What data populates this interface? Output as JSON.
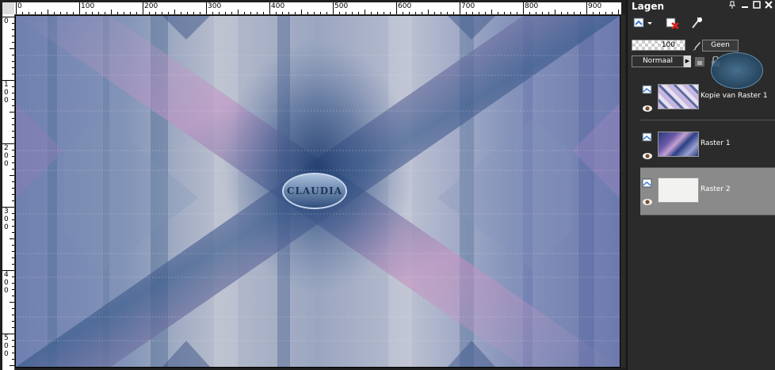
{
  "ruler": {
    "top_labels": [
      "0",
      "100",
      "200",
      "300",
      "400",
      "500",
      "600",
      "700",
      "800",
      "900"
    ],
    "left_labels": [
      "0",
      "100",
      "200",
      "300",
      "400",
      "500"
    ]
  },
  "layers_panel": {
    "title": "Lagen",
    "opacity_value": "100",
    "blend_button": "Geen",
    "mode": "Normaal",
    "layers": [
      {
        "name": "Kopie van Raster 1",
        "selected": false
      },
      {
        "name": "Raster 1",
        "selected": false
      },
      {
        "name": "Raster 2",
        "selected": true
      }
    ]
  },
  "watermark": {
    "text": "CLAUDIA"
  },
  "colors": {
    "workspace_bg": "#1f1f1f",
    "panel_bg": "#2b2b2b",
    "selected_row": "#8a8a8a"
  },
  "icons": [
    "new-layer-icon",
    "delete-layer-icon",
    "mask-icon",
    "paintbrush-icon",
    "lock-icon",
    "eye-icon",
    "raster-layer-icon",
    "pin-icon",
    "close-icon",
    "maximize-icon"
  ]
}
